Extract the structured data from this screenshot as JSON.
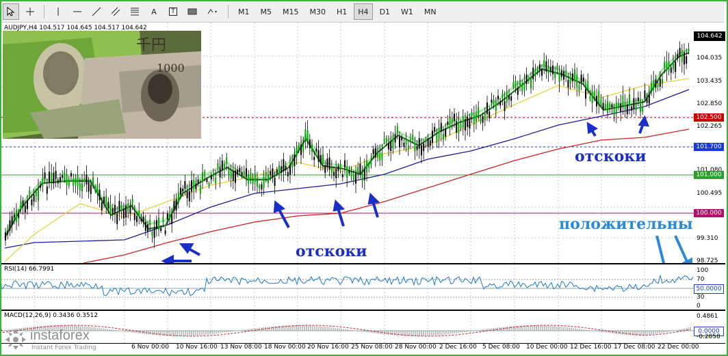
{
  "toolbar": {
    "tools": [
      "cursor-icon",
      "crosshair-icon",
      "vertical-line-icon",
      "horizontal-line-icon",
      "trendline-icon",
      "channel-icon",
      "fibonacci-icon",
      "text-icon",
      "label-icon",
      "rectangle-icon",
      "shapes-icon"
    ],
    "text_tool_label": "A",
    "label_tool_label": "T",
    "timeframes": [
      "M1",
      "M5",
      "M15",
      "M30",
      "H1",
      "H4",
      "D1",
      "W1",
      "MN"
    ],
    "active_timeframe": "H4"
  },
  "chart": {
    "header": "AUDJPY,H4  104.517 104.645 104.517 104.642",
    "price_ticks": [
      "104.642",
      "104.035",
      "103.435",
      "102.850",
      "102.265",
      "101.665",
      "101.080",
      "100.495",
      "99.910",
      "99.310",
      "98.725"
    ],
    "tags": {
      "current": "104.642",
      "level_102500": "102.500",
      "level_101700": "101.700",
      "level_101000": "101.000",
      "level_100000": "100.000"
    },
    "annotations": {
      "bounce_bottom": "отскоки",
      "bounce_right": "отскоки",
      "positive": "положительны"
    }
  },
  "rsi": {
    "header": "RSI(14) 66.7991",
    "ticks": [
      "70",
      "30",
      "0"
    ],
    "top_tick": "100",
    "level_tag": "50.0000"
  },
  "macd": {
    "header": "MACD(12,26,9) 0.3436 0.3512",
    "top_tick": "0.4861",
    "zero_tag": "0.0000",
    "bottom_tick": "-0.2858"
  },
  "x_axis": [
    "6 Nov 00:00",
    "10 Nov 16:00",
    "13 Nov 08:00",
    "18 Nov 00:00",
    "20 Nov 16:00",
    "25 Nov 08:00",
    "28 Nov 00:00",
    "2 Dec 16:00",
    "5 Dec 08:00",
    "10 Dec 00:00",
    "12 Dec 16:00",
    "17 Dec 08:00",
    "22 Dec 00:00"
  ],
  "watermark": {
    "brand": "instaforex",
    "tagline": "Instant Forex Trading"
  },
  "colors": {
    "accent_green": "#3bb33b",
    "price_up": "#00aa00",
    "ma_fast": "#1a7a1a",
    "ma_yellow": "#e8d23c",
    "ma_blue": "#1a1aa0",
    "ma_red": "#cc2222",
    "level_102500": "#cc0000",
    "level_101700": "#1a3ad8",
    "level_101000": "#2e9e2e",
    "level_100000": "#b0106a",
    "annotation_blue": "#1a2fc8",
    "annotation_sky": "#2a8ad8"
  }
}
